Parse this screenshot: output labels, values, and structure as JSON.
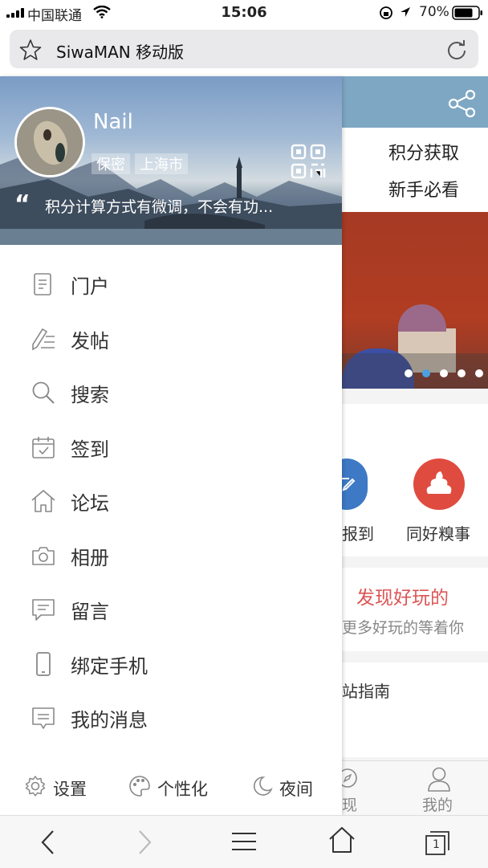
{
  "status_bar": {
    "carrier": "中国联通",
    "time": "15:06",
    "battery": "70%"
  },
  "browser": {
    "title": "SiwaMAN 移动版"
  },
  "background_page": {
    "links": [
      "积分获取",
      "新手必看"
    ],
    "actions": [
      "报到",
      "同好糗事"
    ],
    "discover_title": "发现好玩的",
    "discover_sub": "更多好玩的等着你",
    "guide_text": "站指南",
    "tabs": [
      "现",
      "我的"
    ]
  },
  "drawer": {
    "user": {
      "name": "Nail",
      "tags": [
        "保密",
        "上海市"
      ]
    },
    "quote": "积分计算方式有微调，不会有功...",
    "menu": [
      {
        "label": "门户",
        "icon": "document-icon"
      },
      {
        "label": "发帖",
        "icon": "pen-icon"
      },
      {
        "label": "搜索",
        "icon": "search-icon"
      },
      {
        "label": "签到",
        "icon": "calendar-check-icon"
      },
      {
        "label": "论坛",
        "icon": "home-icon"
      },
      {
        "label": "相册",
        "icon": "camera-icon"
      },
      {
        "label": "留言",
        "icon": "message-icon"
      },
      {
        "label": "绑定手机",
        "icon": "phone-icon"
      },
      {
        "label": "我的消息",
        "icon": "chat-icon"
      }
    ],
    "footer": [
      {
        "label": "设置",
        "icon": "gear-icon"
      },
      {
        "label": "个性化",
        "icon": "palette-icon"
      },
      {
        "label": "夜间",
        "icon": "moon-icon"
      }
    ]
  },
  "toolbar": {
    "tabs_count": "1"
  }
}
